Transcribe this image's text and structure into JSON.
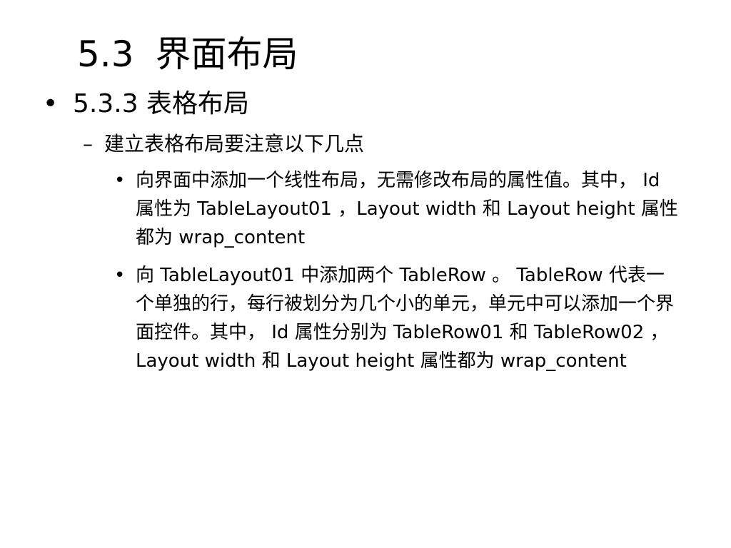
{
  "slide": {
    "title_number": "5.3",
    "title_text": "界面布局",
    "section": "5.3.3  表格布局",
    "subheading": "建立表格布局要注意以下几点",
    "points": [
      "向界面中添加一个线性布局，无需修改布局的属性值。其中， Id 属性为 TableLayout01 ，Layout width 和 Layout height 属性都为 wrap_content",
      "向 TableLayout01 中添加两个 TableRow 。 TableRow 代表一个单独的行，每行被划分为几个小的单元，单元中可以添加一个界面控件。其中， Id 属性分别为 TableRow01 和 TableRow02 ，Layout width 和 Layout height 属性都为 wrap_content"
    ]
  }
}
